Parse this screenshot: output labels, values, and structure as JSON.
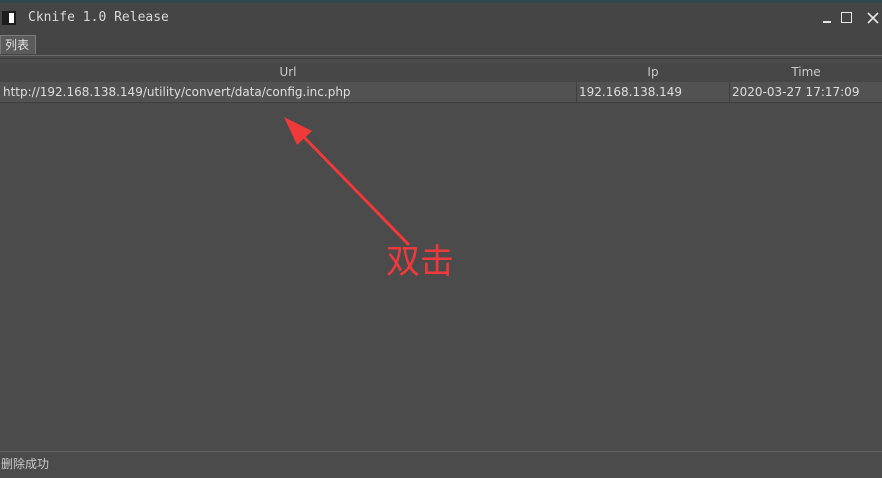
{
  "window": {
    "title": "Cknife 1.0 Release"
  },
  "tabs": [
    {
      "label": "列表"
    }
  ],
  "table": {
    "columns": [
      "Url",
      "Ip",
      "Time"
    ],
    "rows": [
      {
        "url": "http://192.168.138.149/utility/convert/data/config.inc.php",
        "ip": "192.168.138.149",
        "time": "2020-03-27 17:17:09"
      }
    ]
  },
  "annotation": {
    "text": "双击",
    "color": "#f0393a"
  },
  "status": {
    "text": "删除成功"
  },
  "colors": {
    "background": "#4b4b4b",
    "header": "#474747",
    "row": "#525252",
    "text": "#dedede"
  },
  "icons": {
    "app": "app-icon",
    "minimize": "minimize-icon",
    "maximize": "maximize-icon",
    "close": "close-icon",
    "arrow": "arrow-icon"
  }
}
